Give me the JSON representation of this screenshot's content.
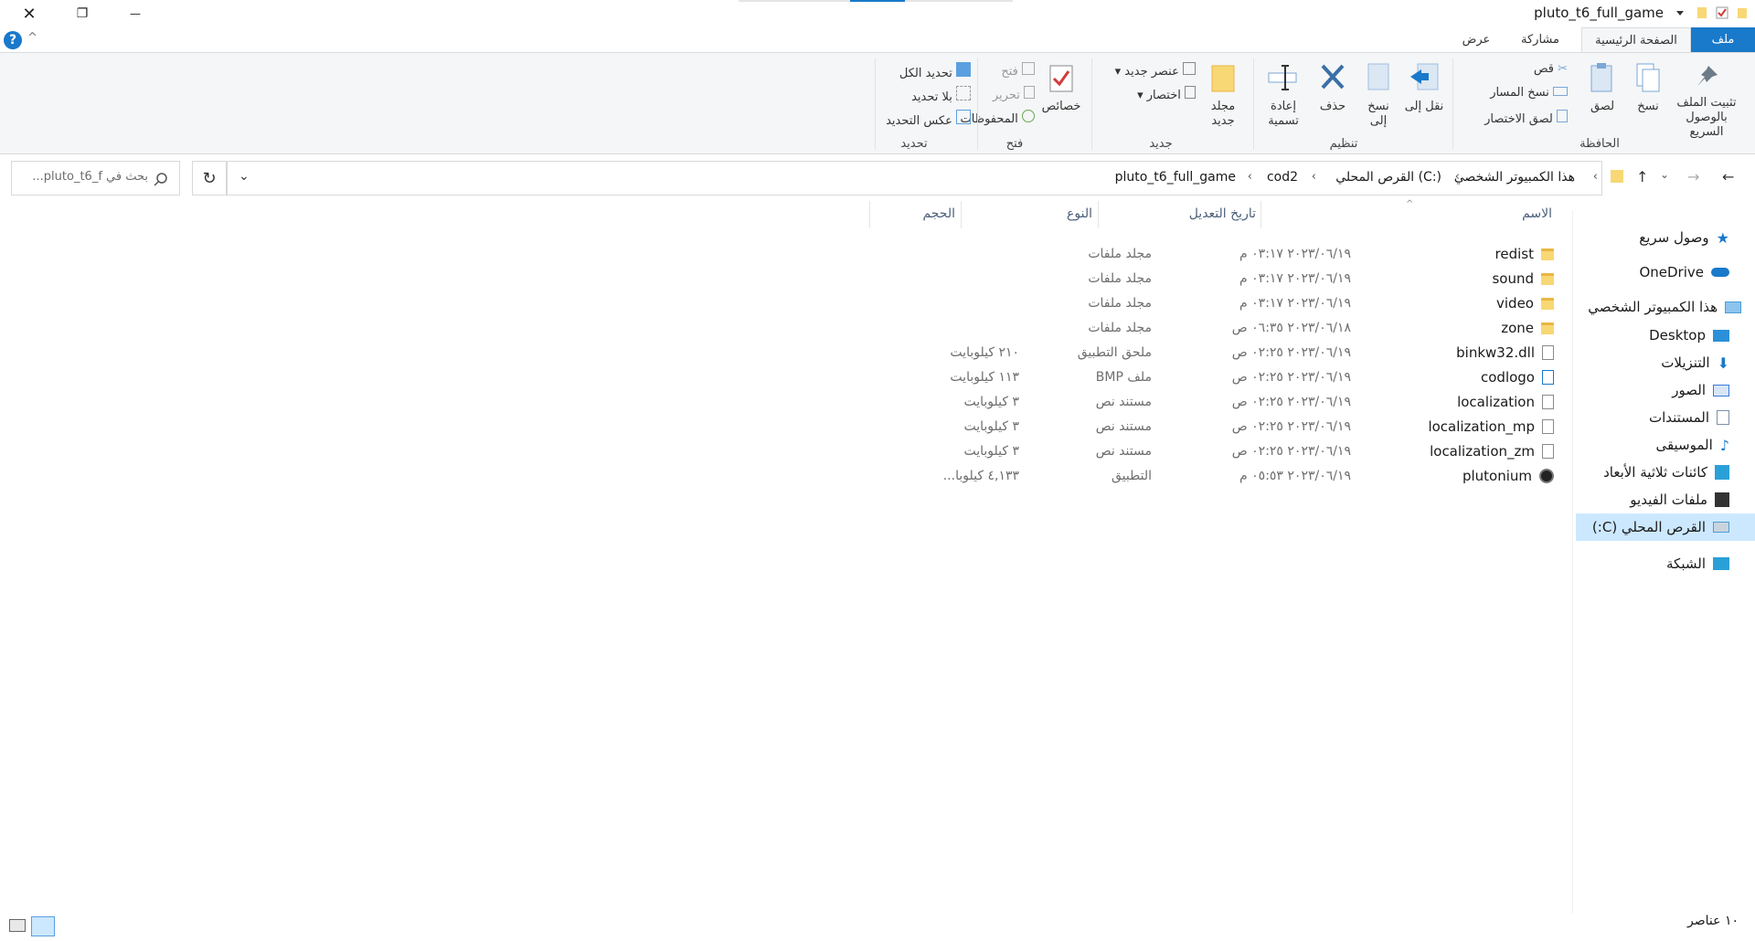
{
  "window": {
    "title": "pluto_t6_full_game",
    "close_glyph": "✕",
    "maximize_glyph": "❐",
    "minimize_glyph": "—"
  },
  "tabs": {
    "file": "ملف",
    "home": "الصفحة الرئيسية",
    "share": "مشاركة",
    "view": "عرض"
  },
  "ribbon": {
    "clipboard": {
      "label": "الحافظة",
      "pin": "تثبيت الملف بالوصول السريع",
      "copy": "نسخ",
      "paste": "لصق",
      "cut": "قص",
      "copy_path": "نسخ المسار",
      "paste_shortcut": "لصق الاختصار"
    },
    "organize": {
      "label": "تنظيم",
      "move_to": "نقل إلى",
      "copy_to": "نسخ إلى",
      "delete": "حذف",
      "rename": "إعادة تسمية"
    },
    "new": {
      "label": "جديد",
      "new_folder": "مجلد جديد",
      "new_item": "عنصر جديد",
      "easy_access": "اختصار"
    },
    "open": {
      "label": "فتح",
      "properties": "خصائص",
      "open": "فتح",
      "edit": "تحرير",
      "history": "المحفوظات"
    },
    "select": {
      "label": "تحديد",
      "select_all": "تحديد الكل",
      "select_none": "بلا تحديد",
      "invert": "عكس التحديد"
    }
  },
  "address": {
    "crumbs": [
      "هذا الكمبيوتر الشخصي",
      "القرص المحلي (C:)",
      "cod2",
      "pluto_t6_full_game"
    ],
    "search_placeholder": "بحث في pluto_t6_f..."
  },
  "nav": [
    {
      "label": "وصول سريع",
      "icon": "star-icon",
      "color": "#1979ca"
    },
    {
      "label": "OneDrive",
      "icon": "cloud-icon",
      "color": "#1979ca"
    },
    {
      "label": "هذا الكمبيوتر الشخصي",
      "icon": "computer-icon",
      "color": "#4a9fd6"
    },
    {
      "label": "Desktop",
      "icon": "desktop-icon",
      "color": "#2b90d9"
    },
    {
      "label": "التنزيلات",
      "icon": "download-icon",
      "color": "#1979ca"
    },
    {
      "label": "الصور",
      "icon": "pictures-icon",
      "color": "#3a7bd5"
    },
    {
      "label": "المستندات",
      "icon": "documents-icon",
      "color": "#7a8fa6"
    },
    {
      "label": "الموسيقى",
      "icon": "music-icon",
      "color": "#1979ca"
    },
    {
      "label": "كائنات ثلاثية الأبعاد",
      "icon": "cube-icon",
      "color": "#2aa0d8"
    },
    {
      "label": "ملفات الفيديو",
      "icon": "video-icon",
      "color": "#333333"
    },
    {
      "label": "القرص المحلي (C:)",
      "icon": "drive-icon",
      "color": "#4a9fd6"
    },
    {
      "label": "الشبكة",
      "icon": "network-icon",
      "color": "#2aa0d8"
    }
  ],
  "columns": {
    "name": "الاسم",
    "modified": "تاريخ التعديل",
    "type": "النوع",
    "size": "الحجم"
  },
  "files": [
    {
      "name": "redist",
      "date": "٢٠٢٣/٠٦/١٩ ٠٣:١٧ م",
      "type": "مجلد ملفات",
      "size": "",
      "icon": "folder-icon"
    },
    {
      "name": "sound",
      "date": "٢٠٢٣/٠٦/١٩ ٠٣:١٧ م",
      "type": "مجلد ملفات",
      "size": "",
      "icon": "folder-icon"
    },
    {
      "name": "video",
      "date": "٢٠٢٣/٠٦/١٩ ٠٣:١٧ م",
      "type": "مجلد ملفات",
      "size": "",
      "icon": "folder-icon"
    },
    {
      "name": "zone",
      "date": "٢٠٢٣/٠٦/١٨ ٠٦:٣٥ ص",
      "type": "مجلد ملفات",
      "size": "",
      "icon": "folder-icon"
    },
    {
      "name": "binkw32.dll",
      "date": "٢٠٢٣/٠٦/١٩ ٠٢:٢٥ ص",
      "type": "ملحق التطبيق",
      "size": "٢١٠ كيلوبايت",
      "icon": "dll-icon"
    },
    {
      "name": "codlogo",
      "date": "٢٠٢٣/٠٦/١٩ ٠٢:٢٥ ص",
      "type": "ملف BMP",
      "size": "١١٣ كيلوبايت",
      "icon": "bmp-icon"
    },
    {
      "name": "localization",
      "date": "٢٠٢٣/٠٦/١٩ ٠٢:٢٥ ص",
      "type": "مستند نص",
      "size": "٣ كيلوبايت",
      "icon": "text-file-icon"
    },
    {
      "name": "localization_mp",
      "date": "٢٠٢٣/٠٦/١٩ ٠٢:٢٥ ص",
      "type": "مستند نص",
      "size": "٣ كيلوبايت",
      "icon": "text-file-icon"
    },
    {
      "name": "localization_zm",
      "date": "٢٠٢٣/٠٦/١٩ ٠٢:٢٥ ص",
      "type": "مستند نص",
      "size": "٣ كيلوبايت",
      "icon": "text-file-icon"
    },
    {
      "name": "plutonium",
      "date": "٢٠٢٣/٠٦/١٩ ٠٥:٥٣ م",
      "type": "التطبيق",
      "size": "٤,١٣٣ كيلوبا...",
      "icon": "app-icon"
    }
  ],
  "status": {
    "count": "١٠ عناصر"
  }
}
